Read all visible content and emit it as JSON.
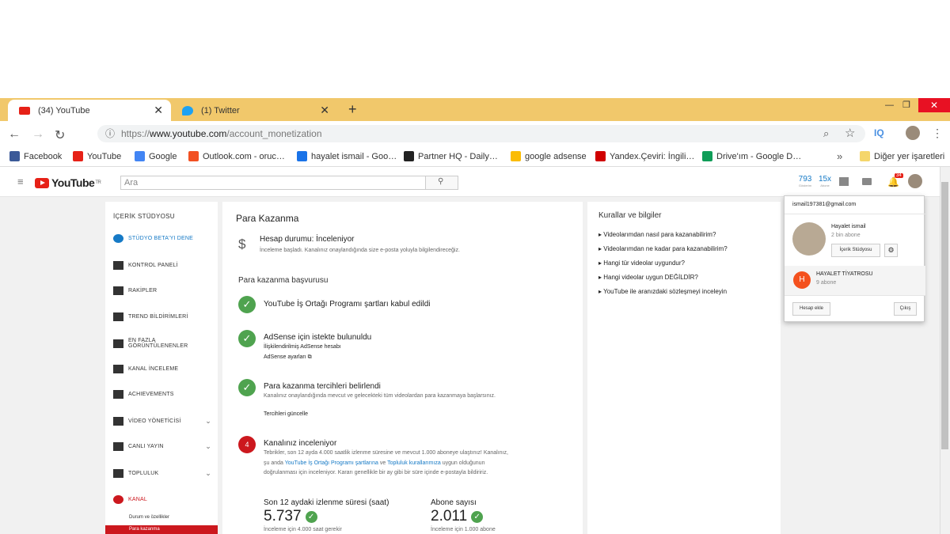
{
  "browser": {
    "tabs": [
      {
        "title": "(34) YouTube",
        "close": "✕"
      },
      {
        "title": "(1) Twitter",
        "close": "✕"
      }
    ],
    "new_tab": "+",
    "url_prefix": "https://",
    "url_domain": "www.youtube.com",
    "url_path": "/account_monetization",
    "iq_label": "IQ",
    "bookmarks": [
      {
        "label": "Facebook",
        "color": "#3b5998"
      },
      {
        "label": "YouTube",
        "color": "#e62117"
      },
      {
        "label": "Google",
        "color": "#4285f4"
      },
      {
        "label": "Outlook.com - oruc…",
        "color": "#f25022"
      },
      {
        "label": "hayalet ismail - Goo…",
        "color": "#1a73e8"
      },
      {
        "label": "Partner HQ - Daily…",
        "color": "#222222"
      },
      {
        "label": "google adsense",
        "color": "#fbbc04"
      },
      {
        "label": "Yandex.Çeviri: İngili…",
        "color": "#d00000"
      },
      {
        "label": "Drive'ım - Google D…",
        "color": "#0f9d58"
      }
    ],
    "bookmarks_more": "»",
    "other_bookmarks": "Diğer yer işaretleri"
  },
  "youtube": {
    "logo": "YouTube",
    "logo_region": "TR",
    "search_placeholder": "Ara",
    "views_count": "793",
    "views_label": "Gösterim",
    "hours_count": "15x",
    "hours_label": "Abone",
    "notif_count": "34"
  },
  "sidebar": {
    "title": "İÇERİK STÜDYOSU",
    "items": [
      {
        "label": "STÜDYO BETA'YI DENE"
      },
      {
        "label": "KONTROL PANELİ"
      },
      {
        "label": "RAKİPLER"
      },
      {
        "label": "TREND BİLDİRİMLERİ"
      },
      {
        "label": "EN FAZLA GÖRÜNTÜLENENLER"
      },
      {
        "label": "KANAL İNCELEME"
      },
      {
        "label": "ACHIEVEMENTS"
      },
      {
        "label": "VİDEO YÖNETİCİSİ"
      },
      {
        "label": "CANLI YAYIN"
      },
      {
        "label": "TOPLULUK"
      },
      {
        "label": "KANAL"
      }
    ],
    "sub_items": [
      "Durum ve özellikler",
      "Para kazanma"
    ]
  },
  "main": {
    "title": "Para Kazanma",
    "status_title": "Hesap durumu: İnceleniyor",
    "status_desc": "İnceleme başladı. Kanalınız onaylandığında size e-posta yoluyla bilgilendireceğiz.",
    "section_title": "Para kazanma başvurusu",
    "step1_title": "YouTube İş Ortağı Programı şartları kabul edildi",
    "step2_title": "AdSense için istekte bulunuldu",
    "step2_link1": "İlişkilendirilmiş AdSense hesabı",
    "step2_link2": "AdSense ayarları",
    "step3_title": "Para kazanma tercihleri belirlendi",
    "step3_desc": "Kanalınız onaylandığında mevcut ve gelecekteki tüm videolardan para kazanmaya başlarsınız.",
    "step3_link": "Tercihleri güncelle",
    "step4_number": "4",
    "step4_title": "Kanalınız inceleniyor",
    "step4_desc_a": "Tebrikler, son 12 ayda 4.000 saatlik izlenme süresine ve mevcut 1.000 aboneye ulaştınız! Kanalınız, şu anda",
    "step4_link_a": "YouTube İş Ortağı Programı şartlarına",
    "step4_desc_b": "ve",
    "step4_link_b": "Topluluk kurallarımıza",
    "step4_desc_c": "uygun olduğunun doğrulanması için inceleniyor. Kararı genellikle bir ay gibi bir süre içinde e-postayla bildiririz.",
    "metric1_label": "Son 12 aydaki izlenme süresi (saat)",
    "metric1_value": "5.737",
    "metric1_note": "İnceleme için 4.000 saat gerekir",
    "metric2_label": "Abone sayısı",
    "metric2_value": "2.011",
    "metric2_note": "İnceleme için 1.000 abone"
  },
  "rules": {
    "title": "Kurallar ve bilgiler",
    "items": [
      "Videolarımdan nasıl para kazanabilirim?",
      "Videolarımdan ne kadar para kazanabilirim?",
      "Hangi tür videolar uygundur?",
      "Hangi videolar uygun DEĞİLDİR?",
      "YouTube ile aranızdaki sözleşmeyi inceleyin"
    ]
  },
  "account_popup": {
    "email": "ismail197381@gmail.com",
    "name": "Hayalet ismail",
    "subscribers": "2 bin abone",
    "studio_button": "İçerik Stüdyosu",
    "other_initial": "H",
    "other_name": "HAYALET TİYATROSU",
    "other_subs": "9 abone",
    "add_account": "Hesap ekle",
    "sign_out": "Çıkış",
    "other_color": "#f4511e"
  }
}
